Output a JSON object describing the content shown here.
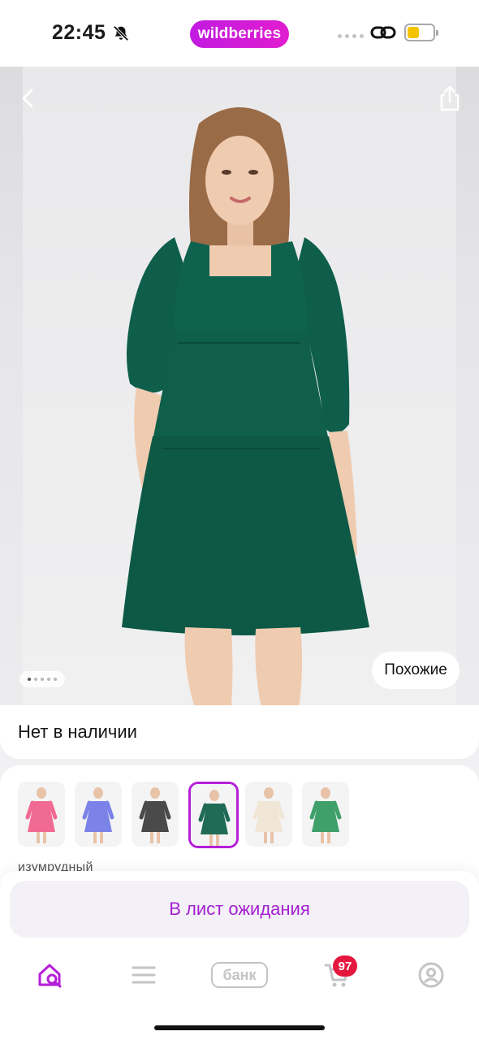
{
  "status_bar": {
    "time": "22:45",
    "brand": "wildberries",
    "battery_level": 0.45,
    "icons": [
      "bell-slash-icon",
      "signal-dots-icon",
      "link-icon",
      "battery-icon"
    ]
  },
  "product": {
    "image_icons": [
      "back-chevron-icon",
      "share-icon"
    ],
    "gallery_dot_count": 5,
    "gallery_active_index": 0,
    "similar_label": "Похожие"
  },
  "availability": {
    "text": "Нет в наличии"
  },
  "variants": {
    "selected_color_name": "изумрудный",
    "swatches": [
      {
        "color": "#f06a93"
      },
      {
        "color": "#7b82e8"
      },
      {
        "color": "#4a4a4a"
      },
      {
        "color": "#1f6b56",
        "selected": true
      },
      {
        "color": "#f0e6d6"
      },
      {
        "color": "#3fa06a"
      }
    ]
  },
  "actions": {
    "waitlist_label": "В лист ожидания"
  },
  "bottom_nav": {
    "bank_label": "банк",
    "cart_badge": "97",
    "items": [
      "home-search-icon",
      "catalog-menu-icon",
      "bank-icon",
      "cart-icon",
      "profile-icon"
    ]
  },
  "colors": {
    "accent": "#b51fd9",
    "brand_gradient_start": "#c21be0",
    "badge": "#e4173f"
  }
}
